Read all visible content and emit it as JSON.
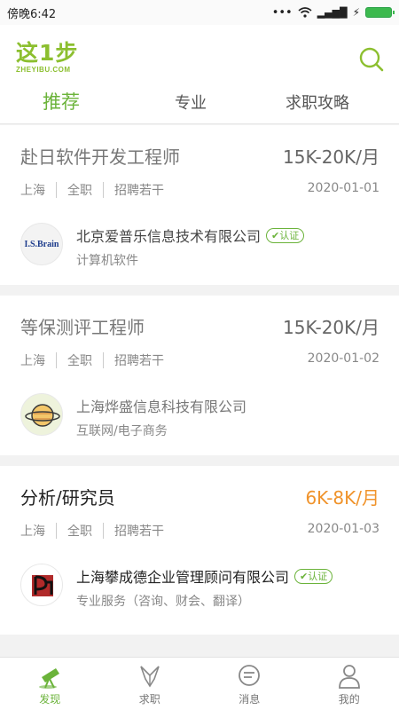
{
  "status": {
    "time": "傍晚6:42",
    "dots": "•••",
    "signal": "▂▄▆█"
  },
  "header": {
    "logo_main": "这1步",
    "logo_sub": "ZHEYIBU.COM",
    "tabs": [
      {
        "label": "推荐",
        "active": true
      },
      {
        "label": "专业",
        "active": false
      },
      {
        "label": "求职攻略",
        "active": false
      }
    ]
  },
  "jobs": [
    {
      "title": "赴日软件开发工程师",
      "salary": "15K-20K/月",
      "location": "上海",
      "type": "全职",
      "hiring": "招聘若干",
      "date": "2020-01-01",
      "company": "北京爱普乐信息技术有限公司",
      "verified": "认证",
      "industry": "计算机软件",
      "logo_text": "I.S.Brain"
    },
    {
      "title": "等保测评工程师",
      "salary": "15K-20K/月",
      "location": "上海",
      "type": "全职",
      "hiring": "招聘若干",
      "date": "2020-01-02",
      "company": "上海烨盛信息科技有限公司",
      "industry": "互联网/电子商务"
    },
    {
      "title": "分析/研究员",
      "salary": "6K-8K/月",
      "location": "上海",
      "type": "全职",
      "hiring": "招聘若干",
      "date": "2020-01-03",
      "company": "上海攀成德企业管理顾问有限公司",
      "verified": "认证",
      "industry": "专业服务（咨询、财会、翻译）"
    }
  ],
  "nav": [
    {
      "label": "发现",
      "icon": "telescope-icon",
      "active": true
    },
    {
      "label": "求职",
      "icon": "origami-icon",
      "active": false
    },
    {
      "label": "消息",
      "icon": "chat-icon",
      "active": false
    },
    {
      "label": "我的",
      "icon": "user-icon",
      "active": false
    }
  ],
  "colors": {
    "brand_green": "#6bb33a",
    "salary_orange": "#f0932b"
  }
}
